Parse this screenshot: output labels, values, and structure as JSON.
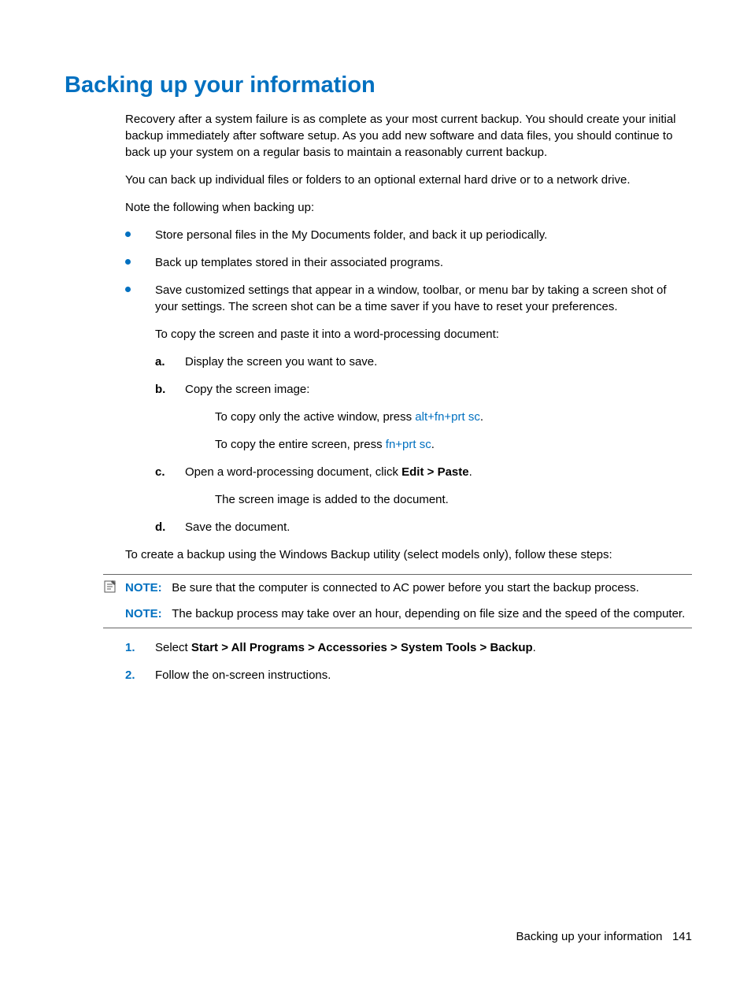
{
  "title": "Backing up your information",
  "p1": "Recovery after a system failure is as complete as your most current backup. You should create your initial backup immediately after software setup. As you add new software and data files, you should continue to back up your system on a regular basis to maintain a reasonably current backup.",
  "p2": "You can back up individual files or folders to an optional external hard drive or to a network drive.",
  "p3": "Note the following when backing up:",
  "bullets": {
    "b1": "Store personal files in the My Documents folder, and back it up periodically.",
    "b2": "Back up templates stored in their associated programs.",
    "b3": "Save customized settings that appear in a window, toolbar, or menu bar by taking a screen shot of your settings. The screen shot can be a time saver if you have to reset your preferences.",
    "b3_sub": "To copy the screen and paste it into a word-processing document:"
  },
  "steps": {
    "a_marker": "a.",
    "a": "Display the screen you want to save.",
    "b_marker": "b.",
    "b": "Copy the screen image:",
    "b_sub1_pre": "To copy only the active window, press ",
    "b_sub1_key": "alt+fn+prt sc",
    "b_sub1_post": ".",
    "b_sub2_pre": "To copy the entire screen, press ",
    "b_sub2_key": "fn+prt sc",
    "b_sub2_post": ".",
    "c_marker": "c.",
    "c_pre": "Open a word-processing document, click ",
    "c_bold": "Edit > Paste",
    "c_post": ".",
    "c_sub": "The screen image is added to the document.",
    "d_marker": "d.",
    "d": "Save the document."
  },
  "p4": "To create a backup using the Windows Backup utility (select models only), follow these steps:",
  "note1_label": "NOTE:",
  "note1": "Be sure that the computer is connected to AC power before you start the backup process.",
  "note2_label": "NOTE:",
  "note2": "The backup process may take over an hour, depending on file size and the speed of the computer.",
  "numlist": {
    "n1_marker": "1.",
    "n1_pre": "Select ",
    "n1_bold": "Start > All Programs > Accessories > System Tools > Backup",
    "n1_post": ".",
    "n2_marker": "2.",
    "n2": "Follow the on-screen instructions."
  },
  "footer_text": "Backing up your information",
  "footer_page": "141"
}
